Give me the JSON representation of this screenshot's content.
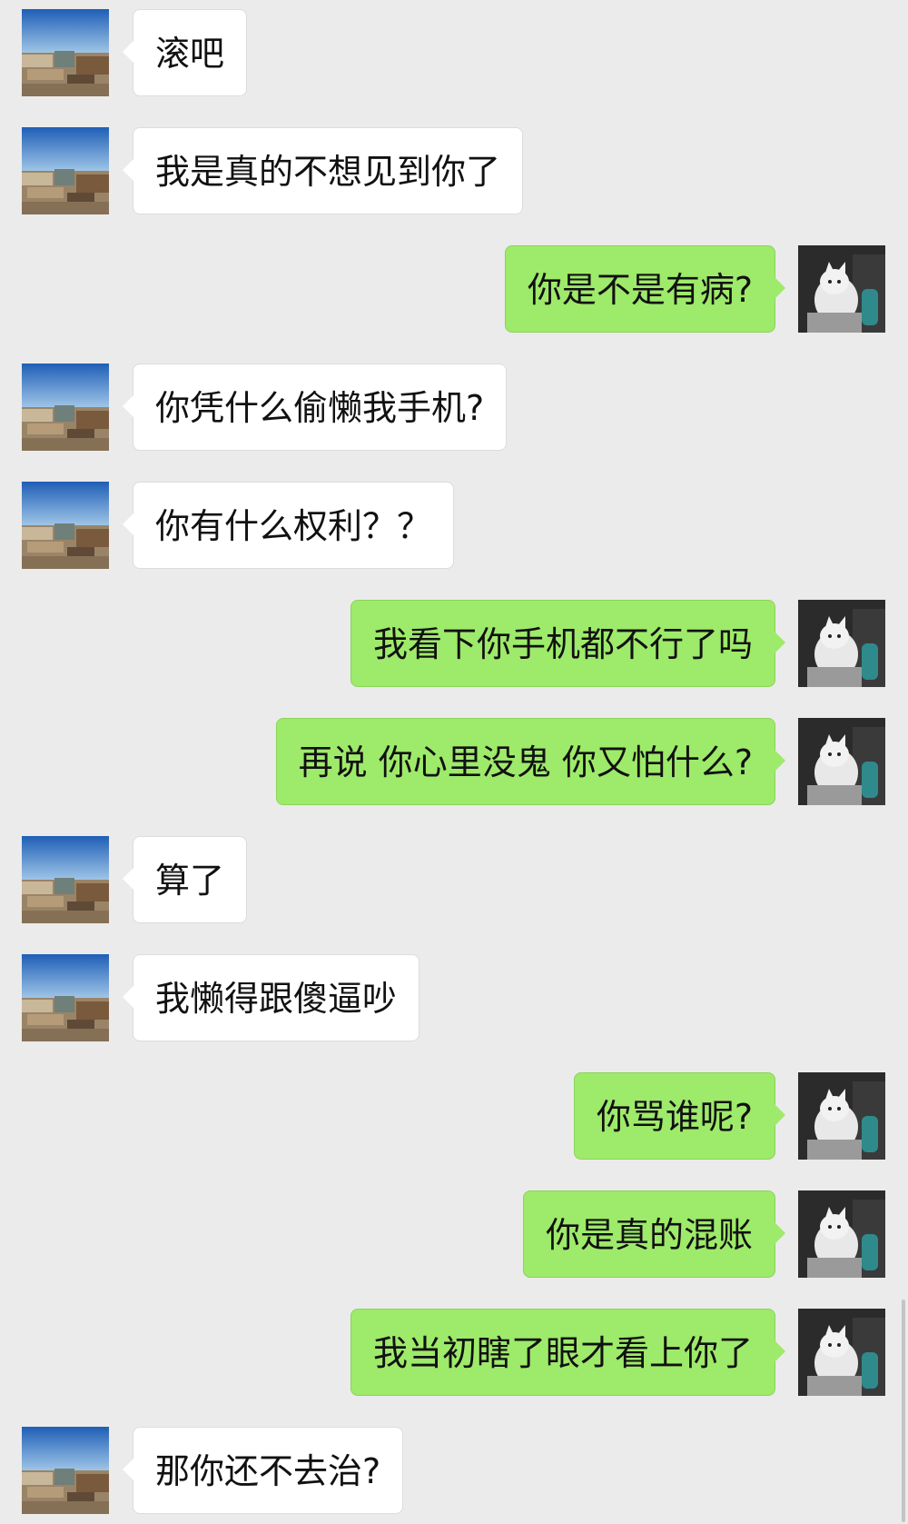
{
  "messages": [
    {
      "from": "other",
      "text": "滚吧"
    },
    {
      "from": "other",
      "text": "我是真的不想见到你了"
    },
    {
      "from": "me",
      "text": "你是不是有病?"
    },
    {
      "from": "other",
      "text": "你凭什么偷懒我手机?"
    },
    {
      "from": "other",
      "text": "你有什么权利？？"
    },
    {
      "from": "me",
      "text": "我看下你手机都不行了吗"
    },
    {
      "from": "me",
      "text": "再说 你心里没鬼 你又怕什么?"
    },
    {
      "from": "other",
      "text": "算了"
    },
    {
      "from": "other",
      "text": "我懒得跟傻逼吵"
    },
    {
      "from": "me",
      "text": "你骂谁呢?"
    },
    {
      "from": "me",
      "text": "你是真的混账"
    },
    {
      "from": "me",
      "text": "我当初瞎了眼才看上你了"
    },
    {
      "from": "other",
      "text": "那你还不去治?"
    }
  ],
  "colors": {
    "background": "#ebebeb",
    "incoming_bubble": "#ffffff",
    "outgoing_bubble": "#9eea6a"
  },
  "icons": {
    "other_avatar": "landscape-photo-avatar-icon",
    "my_avatar": "cat-photo-avatar-icon"
  }
}
